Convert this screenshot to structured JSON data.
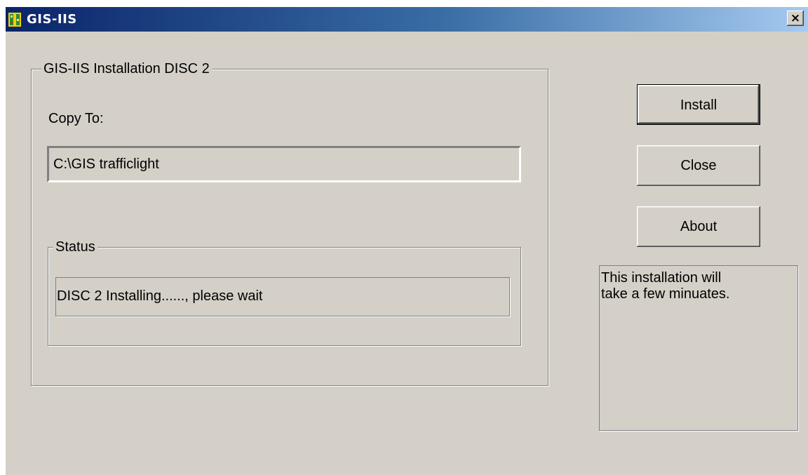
{
  "window": {
    "title": "GIS-IIS",
    "close_glyph": "×",
    "colors": {
      "face": "#d4d0c8",
      "titlebar_start": "#0a246a",
      "titlebar_end": "#a6caf0"
    }
  },
  "main_group": {
    "legend": "GIS-IIS Installation DISC 2",
    "copy_to_label": "Copy To:",
    "copy_to_value": "C:\\GIS trafficlight"
  },
  "status_group": {
    "legend": "Status",
    "message": "DISC 2 Installing......, please wait"
  },
  "buttons": {
    "install": "Install",
    "close": "Close",
    "about": "About"
  },
  "info": {
    "text": "This installation will\ntake a few minuates."
  },
  "icons": {
    "app": "app-icon",
    "close": "close-icon"
  }
}
